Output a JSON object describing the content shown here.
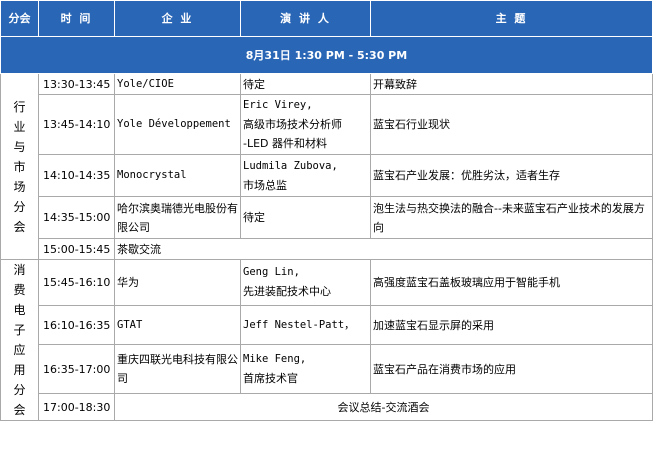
{
  "header": {
    "col_section": "分会",
    "col_time": "时 间",
    "col_company": "企 业",
    "col_speaker": "演 讲 人",
    "col_topic": "主 题"
  },
  "date_row": "8月31日 1:30 PM - 5:30 PM",
  "sections": [
    {
      "label": [
        "行",
        "业",
        "与",
        "市",
        "场",
        "分",
        "会"
      ]
    },
    {
      "label": [
        "消",
        "费",
        "电",
        "子",
        "应",
        "用",
        "分",
        "会"
      ]
    }
  ],
  "rows": [
    {
      "time": "13:30-13:45",
      "company": "Yole/CIOE",
      "speaker": "待定",
      "topic": "开幕致辞"
    },
    {
      "time": "13:45-14:10",
      "company": "Yole Développement",
      "speaker_lines": [
        "Eric Virey,",
        "高级市场技术分析师",
        "-LED 器件和材料"
      ],
      "topic": "蓝宝石行业现状"
    },
    {
      "time": "14:10-14:35",
      "company": "Monocrystal",
      "speaker_lines": [
        "Ludmila Zubova,",
        "市场总监"
      ],
      "topic": "蓝宝石产业发展：优胜劣汰，适者生存"
    },
    {
      "time": "14:35-15:00",
      "company": "哈尔滨奥瑞德光电股份有限公司",
      "speaker": "待定",
      "topic": "泡生法与热交换法的融合--未来蓝宝石产业技术的发展方向"
    },
    {
      "time": "15:00-15:45",
      "break": "茶歇交流"
    },
    {
      "time": "15:45-16:10",
      "company": "华为",
      "speaker_lines": [
        "Geng Lin,",
        "先进装配技术中心"
      ],
      "topic": "高强度蓝宝石盖板玻璃应用于智能手机"
    },
    {
      "time": "16:10-16:35",
      "company": "GTAT",
      "speaker": "Jeff Nestel-Patt，",
      "topic": "加速蓝宝石显示屏的采用"
    },
    {
      "time": "16:35-17:00",
      "company": "重庆四联光电科技有限公司",
      "speaker_lines": [
        "Mike Feng,",
        "首席技术官"
      ],
      "topic": "蓝宝石产品在消费市场的应用"
    },
    {
      "time": "17:00-18:30",
      "closing": "会议总结-交流酒会"
    }
  ]
}
